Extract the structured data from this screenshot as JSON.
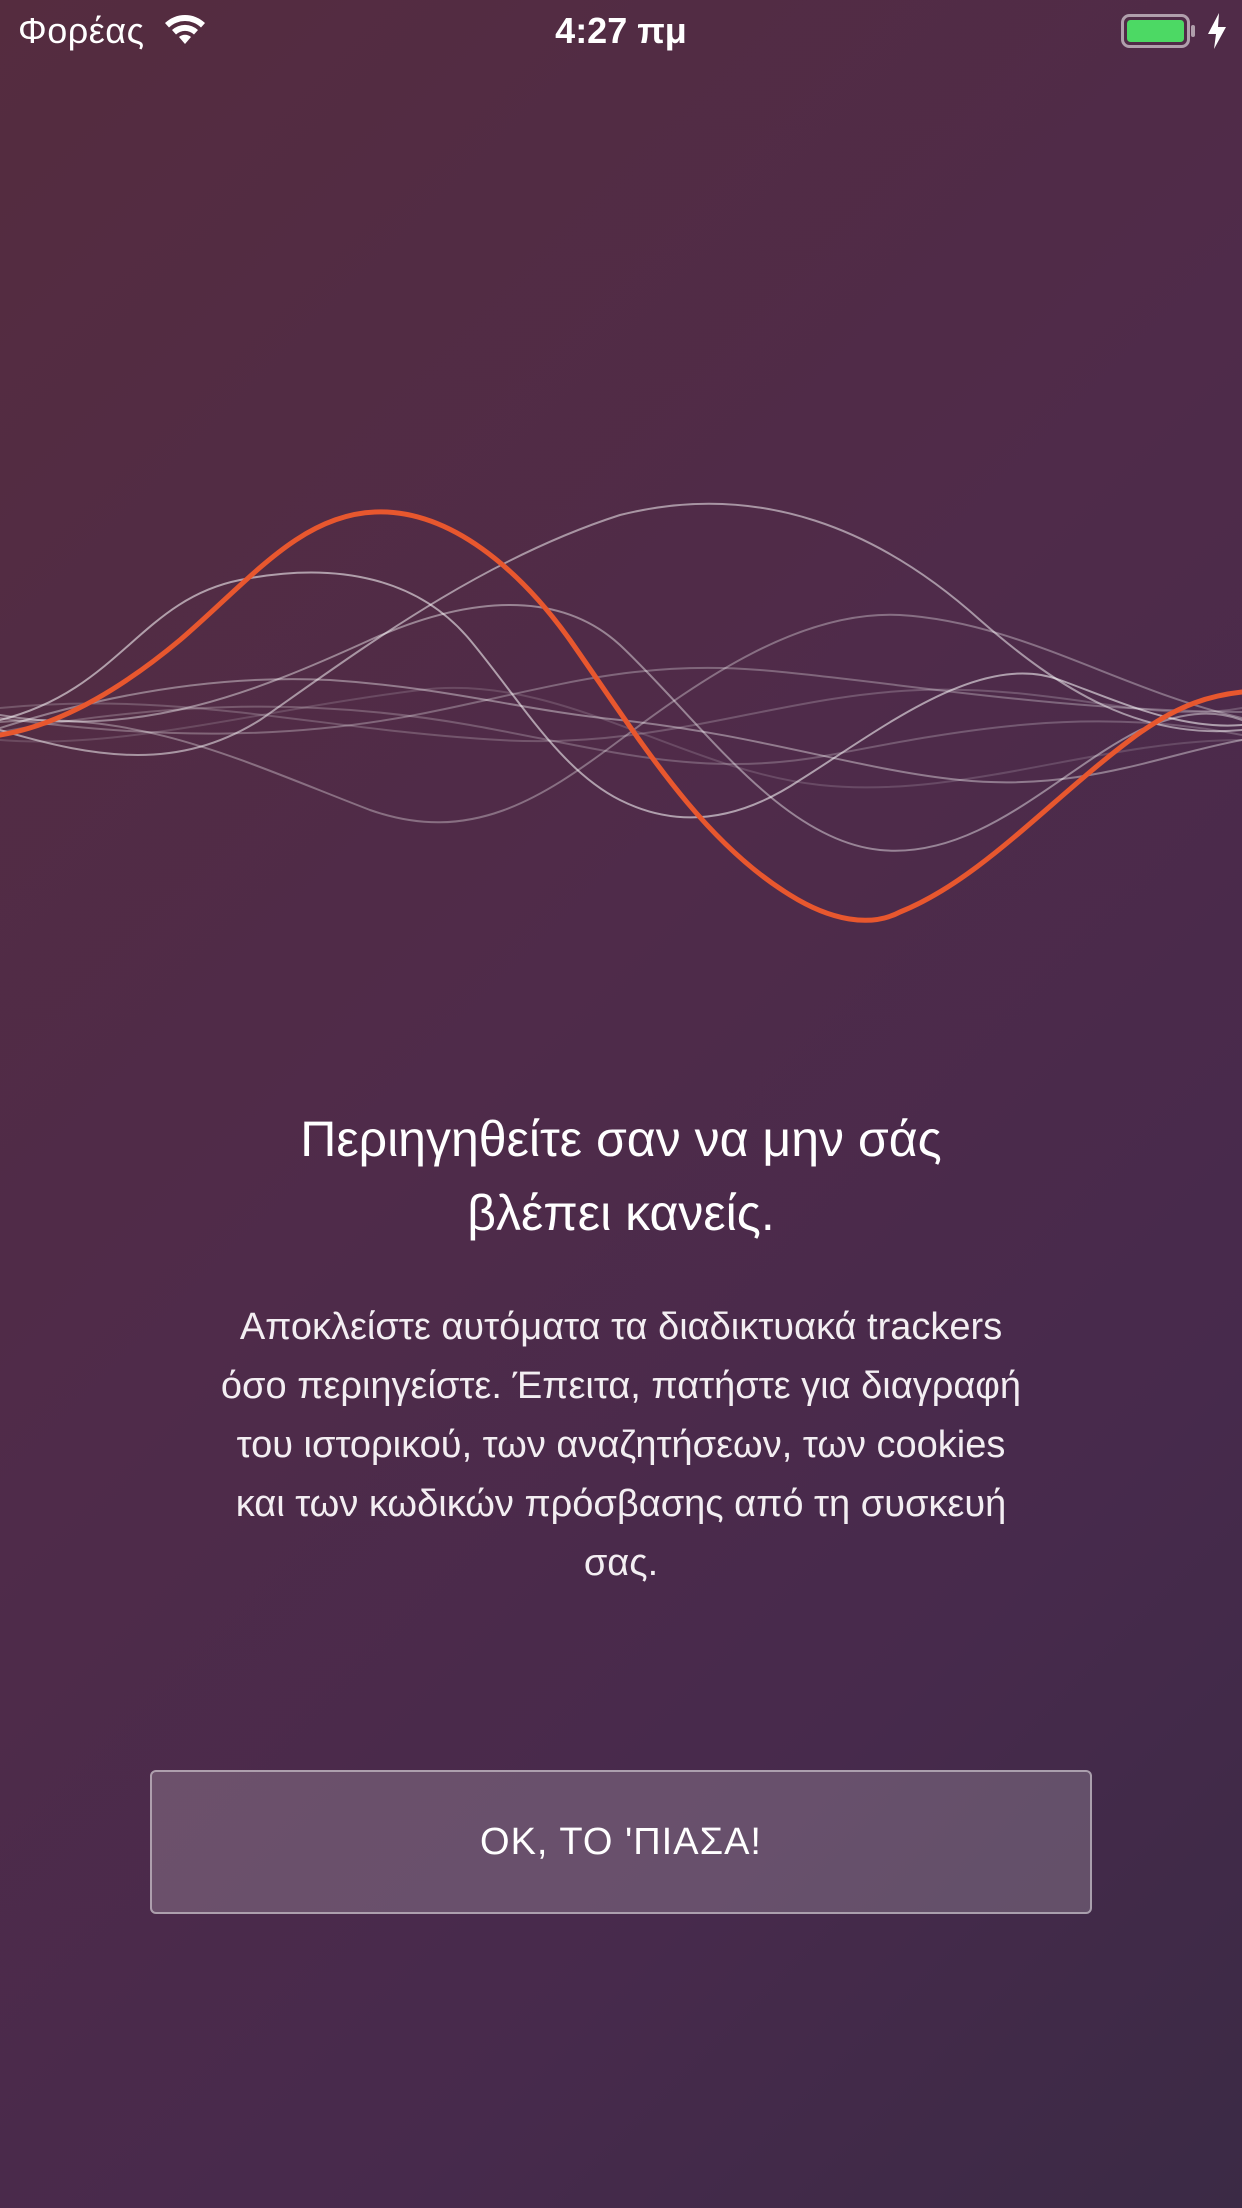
{
  "status_bar": {
    "carrier": "Φορέας",
    "time": "4:27 πμ",
    "wifi_icon": "wifi-icon",
    "battery_icon": "battery-icon",
    "battery_level": 1.0,
    "battery_color": "#4cd964",
    "charging_icon": "bolt-icon"
  },
  "onboarding": {
    "graphic": "sound-wave-illustration",
    "accent_color": "#e8572e",
    "title_line1": "Περιηγηθείτε σαν να μην σάς",
    "title_line2": "βλέπει κανείς.",
    "description_lines": [
      "Αποκλείστε αυτόματα τα διαδικτυακά trackers",
      "όσο περιηγείστε. Έπειτα, πατήστε για διαγραφή",
      "του ιστορικού, των αναζητήσεων, των cookies",
      "και των κωδικών πρόσβασης από τη συσκευή",
      "σας."
    ],
    "button_label": "ΟΚ, ΤΟ 'ΠΙΑΣΑ!"
  }
}
